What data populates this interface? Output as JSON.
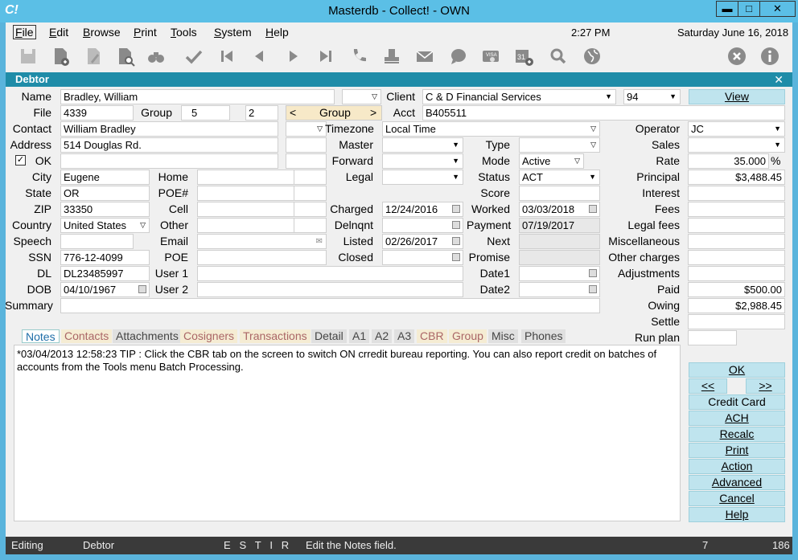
{
  "window": {
    "app_logo": "C!",
    "title": "Masterdb - Collect! - OWN",
    "minimize": "▬",
    "maximize": "□",
    "close": "✕"
  },
  "menu": [
    {
      "pre": "",
      "u": "F",
      "post": "ile"
    },
    {
      "pre": "",
      "u": "E",
      "post": "dit"
    },
    {
      "pre": "",
      "u": "B",
      "post": "rowse"
    },
    {
      "pre": "",
      "u": "P",
      "post": "rint"
    },
    {
      "pre": "",
      "u": "T",
      "post": "ools"
    },
    {
      "pre": "",
      "u": "S",
      "post": "ystem"
    },
    {
      "pre": "",
      "u": "H",
      "post": "elp"
    }
  ],
  "clock": {
    "time": "2:27 PM",
    "date": "Saturday  June 16, 2018"
  },
  "toolbar": [
    "save-icon",
    "new-document-icon",
    "edit-document-icon",
    "search-document-icon",
    "binoculars-icon",
    "check-icon",
    "first-record-icon",
    "previous-record-icon",
    "next-record-icon",
    "last-record-icon",
    "phone-icon",
    "stamp-icon",
    "mail-icon",
    "chat-icon",
    "credit-card-icon",
    "calendar-add-icon",
    "magnifier-icon",
    "globe-icon",
    "cancel-icon",
    "info-icon"
  ],
  "debtor": {
    "header": "Debtor",
    "close": "✕",
    "labels": {
      "name": "Name",
      "client": "Client",
      "file": "File",
      "group": "Group",
      "group_nav": "Group",
      "acct": "Acct",
      "contact": "Contact",
      "timezone": "Timezone",
      "operator": "Operator",
      "address": "Address",
      "master": "Master",
      "type": "Type",
      "sales": "Sales",
      "ok": "OK",
      "forward": "Forward",
      "mode": "Mode",
      "rate": "Rate",
      "city": "City",
      "home": "Home",
      "legal": "Legal",
      "status": "Status",
      "principal": "Principal",
      "state": "State",
      "poe_num": "POE#",
      "score": "Score",
      "interest": "Interest",
      "zip": "ZIP",
      "cell": "Cell",
      "charged": "Charged",
      "worked": "Worked",
      "fees": "Fees",
      "country": "Country",
      "other": "Other",
      "delnqnt": "Delnqnt",
      "payment": "Payment",
      "legal_fees": "Legal fees",
      "speech": "Speech",
      "email": "Email",
      "listed": "Listed",
      "next": "Next",
      "misc": "Miscellaneous",
      "ssn": "SSN",
      "poe": "POE",
      "closed": "Closed",
      "promise": "Promise",
      "other_charges": "Other charges",
      "dl": "DL",
      "user1": "User 1",
      "date1": "Date1",
      "adjustments": "Adjustments",
      "dob": "DOB",
      "user2": "User 2",
      "date2": "Date2",
      "paid": "Paid",
      "summary": "Summary",
      "owing": "Owing",
      "settle": "Settle",
      "run_plan": "Run plan",
      "percent": "%"
    },
    "values": {
      "name": "Bradley, William",
      "client": "C & D Financial Services",
      "client_num": "94",
      "file": "4339",
      "group": "5",
      "group2": "2",
      "acct": "B405511",
      "contact": "William Bradley",
      "timezone": "Local Time",
      "operator": "JC",
      "address": "514 Douglas Rd.",
      "mode": "Active",
      "rate": "35.000",
      "city": "Eugene",
      "status": "ACT",
      "principal": "$3,488.45",
      "state": "OR",
      "zip": "33350",
      "charged": "12/24/2016",
      "worked": "03/03/2018",
      "country": "United States",
      "payment": "07/19/2017",
      "listed": "02/26/2017",
      "ssn": "776-12-4099",
      "dl": "DL23485997",
      "dob": "04/10/1967",
      "paid": "$500.00",
      "owing": "$2,988.45"
    },
    "view_button": "View",
    "group_prev": "<",
    "group_next": ">",
    "ok_checkbox": "✓"
  },
  "tabs": [
    "Notes",
    "Contacts",
    "Attachments",
    "Cosigners",
    "Transactions",
    "Detail",
    "A1",
    "A2",
    "A3",
    "CBR",
    "Group",
    "Misc",
    "Phones"
  ],
  "notes_text": "*03/04/2013 12:58:23 TIP : Click the CBR tab on the screen to switch ON crredit bureau reporting. You can also report credit on batches of accounts from the Tools menu Batch Processing.",
  "side_buttons": {
    "ok": "OK",
    "prev": "<<",
    "next": ">>",
    "credit_card": "Credit Card",
    "ach": "ACH",
    "recalc": "Recalc",
    "print": "Print",
    "action": "Action",
    "advanced": "Advanced",
    "cancel": "Cancel",
    "help": "Help"
  },
  "statusbar": {
    "mode": "Editing",
    "form": "Debtor",
    "flags": "E   S   T   I   R",
    "hint": "Edit the Notes field.",
    "n1": "7",
    "n2": "186"
  }
}
